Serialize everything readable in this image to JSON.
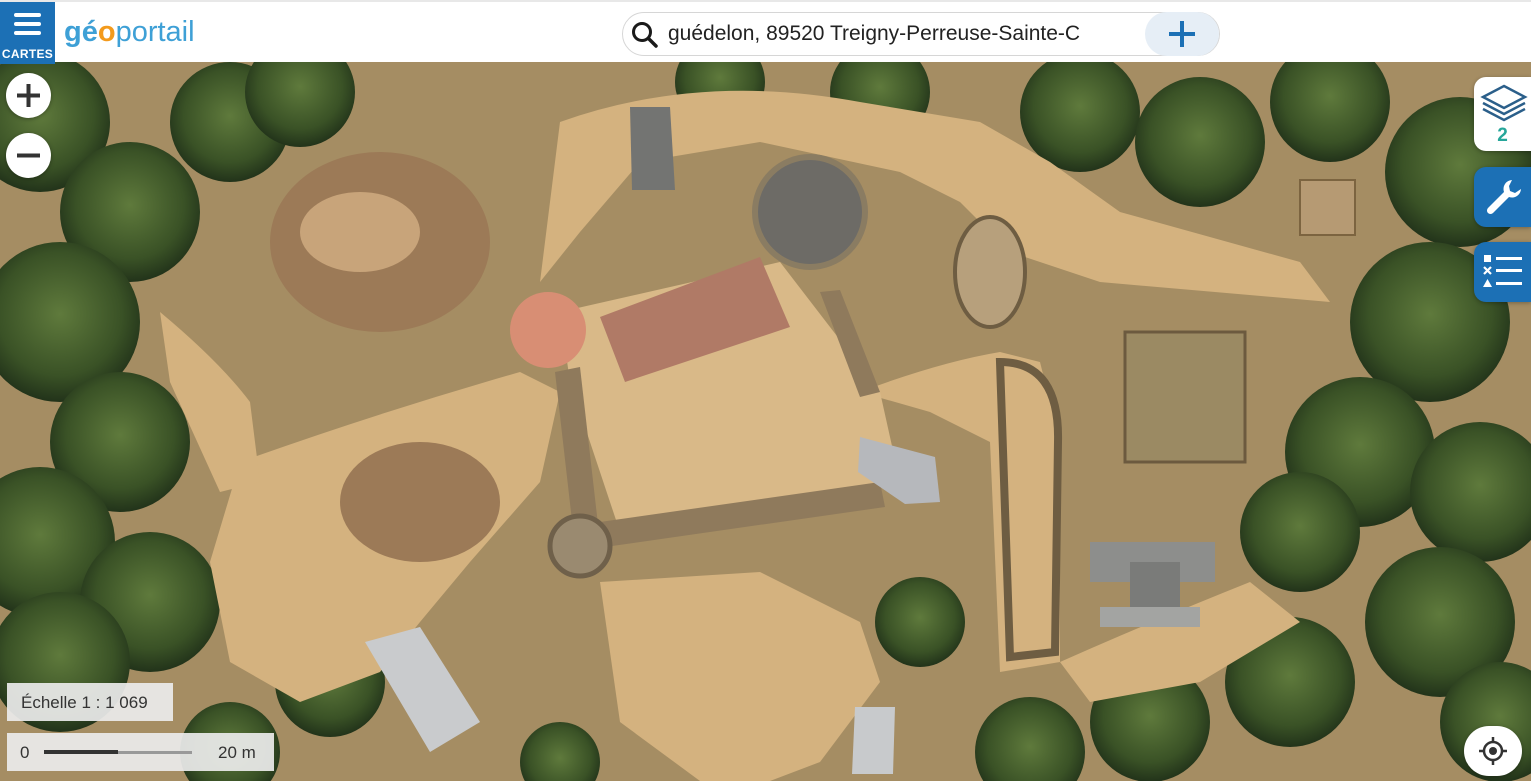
{
  "header": {
    "menu_label": "CARTES",
    "logo": {
      "part1": "gé",
      "part2": "o",
      "part3": "portail"
    },
    "search": {
      "value": "guédelon, 89520 Treigny-Perreuse-Sainte-C"
    }
  },
  "map": {
    "layers_count": "2",
    "scale_label": "Échelle 1 : 1 069",
    "scalebar_start": "0",
    "scalebar_end": "20 m"
  },
  "colors": {
    "brand_blue": "#1c70b5",
    "logo_blue": "#3ea0d6",
    "logo_orange": "#f39a1c",
    "layer_count_teal": "#26a69a"
  },
  "icons": [
    "menu-icon",
    "search-icon",
    "plus-icon",
    "zoom-in-icon",
    "zoom-out-icon",
    "layers-icon",
    "wrench-icon",
    "legend-list-icon",
    "locate-icon"
  ]
}
